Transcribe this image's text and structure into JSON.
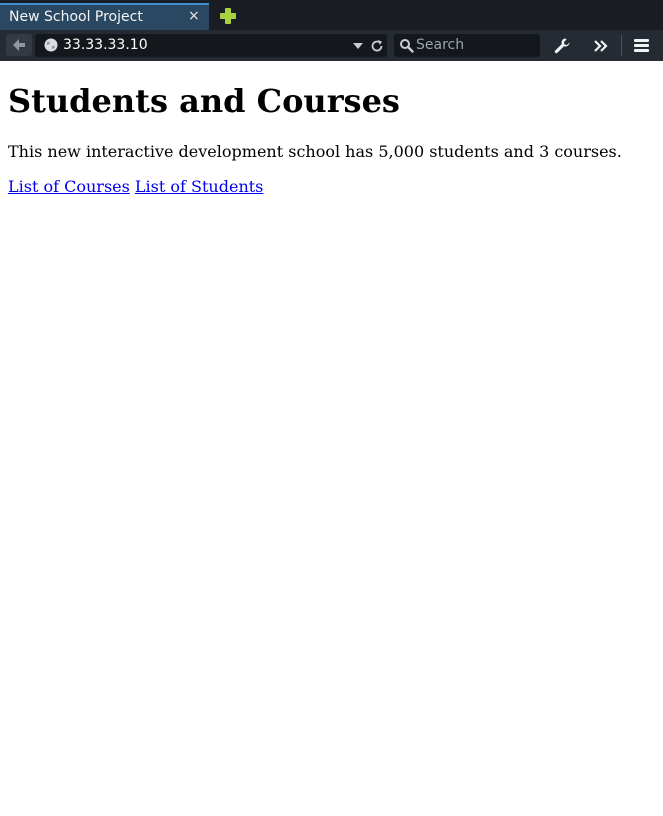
{
  "browser": {
    "tab": {
      "title": "New School Project",
      "close_glyph": "×"
    },
    "url": "33.33.33.10",
    "search": {
      "placeholder": "Search",
      "value": ""
    },
    "icons": {
      "back": "back-arrow-icon",
      "new_tab": "plus-icon",
      "site": "globe-icon",
      "dropdown": "chevron-down-icon",
      "reload": "reload-icon",
      "search": "search-icon",
      "tools": "wrench-icon",
      "overflow": "double-chevron-right-icon",
      "menu": "hamburger-menu-icon"
    },
    "colors": {
      "chrome_bg": "#1f242b",
      "active_tab": "#2b4862",
      "tab_accent": "#3f8fd2",
      "new_tab_plus": "#a8d13f"
    }
  },
  "page": {
    "heading": "Students and Courses",
    "intro": "This new interactive development school has 5,000 students and 3 courses.",
    "links": [
      {
        "label": "List of Courses"
      },
      {
        "label": "List of Students"
      }
    ],
    "colors": {
      "link": "#0000ee"
    }
  }
}
